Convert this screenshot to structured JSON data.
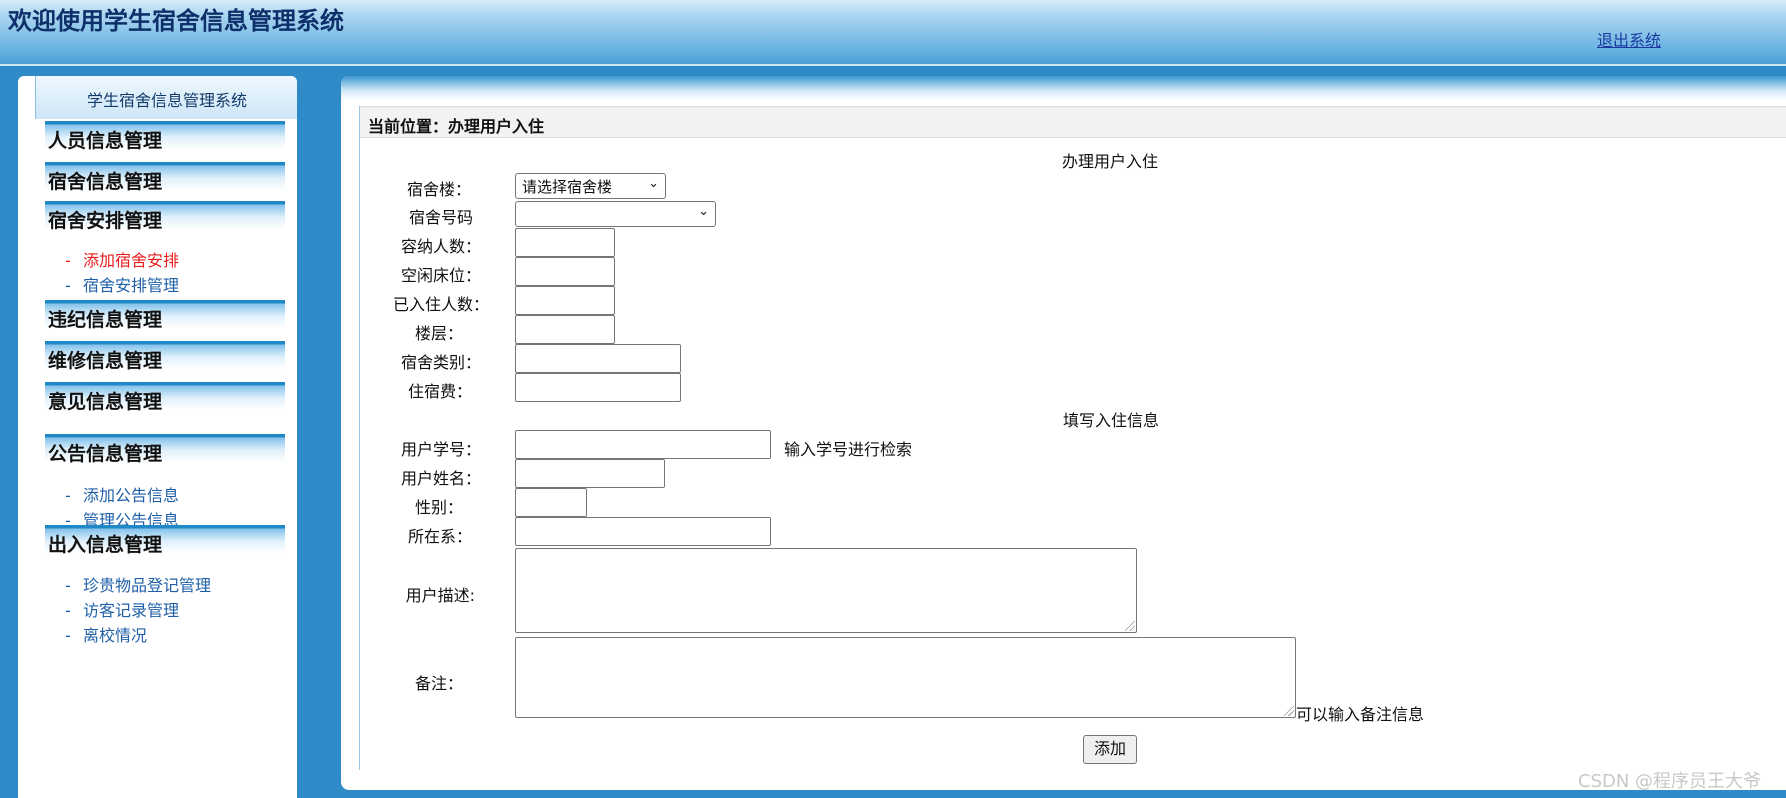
{
  "header": {
    "title": "欢迎使用学生宿舍信息管理系统",
    "logout": "退出系统"
  },
  "sidebar": {
    "title": "学生宿舍信息管理系统",
    "items": [
      {
        "label": "人员信息管理"
      },
      {
        "label": "宿舍信息管理"
      },
      {
        "label": "宿舍安排管理",
        "links": [
          "添加宿舍安排",
          "宿舍安排管理"
        ]
      },
      {
        "label": "违纪信息管理"
      },
      {
        "label": "维修信息管理"
      },
      {
        "label": "意见信息管理"
      },
      {
        "label": "公告信息管理",
        "links": [
          "添加公告信息",
          "管理公告信息"
        ]
      },
      {
        "label": "出入信息管理",
        "links": [
          "珍贵物品登记管理",
          "访客记录管理",
          "离校情况"
        ]
      }
    ],
    "dash": "-"
  },
  "main": {
    "breadcrumb": "当前位置：办理用户入住",
    "section1_title": "办理用户入住",
    "section2_title": "填写入住信息",
    "form": {
      "building_label": "宿舍楼：",
      "building_value": "请选择宿舍楼",
      "room_label": "宿舍号码",
      "room_value": "",
      "capacity_label": "容纳人数：",
      "free_beds_label": "空闲床位：",
      "occupied_label": "已入住人数：",
      "floor_label": "楼层：",
      "type_label": "宿舍类别：",
      "fee_label": "住宿费：",
      "student_id_label": "用户学号：",
      "student_id_hint": "输入学号进行检索",
      "name_label": "用户姓名：",
      "gender_label": "性别：",
      "dept_label": "所在系：",
      "desc_label": "用户描述:",
      "remark_label": "备注：",
      "remark_hint": "可以输入备注信息",
      "submit": "添加"
    }
  },
  "watermark": "CSDN @程序员王大爷"
}
